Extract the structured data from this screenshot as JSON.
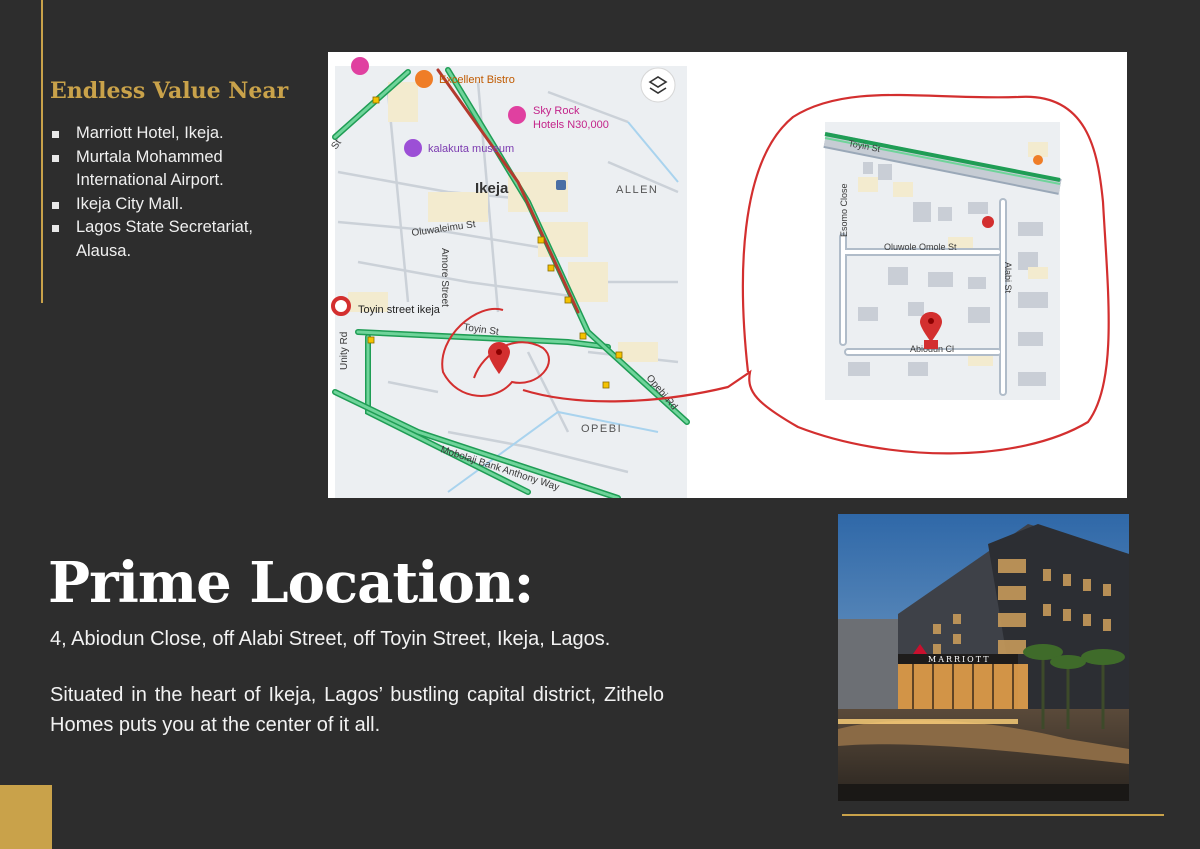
{
  "near": {
    "title": "Endless Value Near",
    "items": [
      "Marriott Hotel, Ikeja.",
      "Murtala Mohammed International Airport.",
      "Ikeja City Mall.",
      "Lagos State Secretariat, Alausa."
    ]
  },
  "map": {
    "excellent_bistro": "Excellent Bistro",
    "sky_rock_1": "Sky Rock",
    "sky_rock_2": "Hotels N30,000",
    "kalakuta": "kalakuta museum",
    "ikeja": "Ikeja",
    "allen": "ALLEN",
    "oluwaleimu": "Oluwaleimu St",
    "amore": "Amore Street",
    "toyin_ikeja": "Toyin street ikeja",
    "toyin_st": "Toyin St",
    "unity": "Unity Rd",
    "opebi_rd": "Opebi Rd",
    "opebi": "OPEBI",
    "mobolaji": "Mobolaji Bank Anthony Way",
    "st": "St",
    "zoom_toyin": "Toyin St",
    "zoom_esomo": "Esomo Close",
    "zoom_oluwole": "Oluwole Omole St",
    "zoom_alabi": "Alabi St",
    "zoom_abiodun": "Abiodun Cl"
  },
  "hotel_sign": "MARRIOTT",
  "headline": "Prime Location:",
  "address": "4, Abiodun Close, off Alabi Street, off Toyin Street, Ikeja, Lagos.",
  "description": "Situated in the heart of Ikeja, Lagos’ bustling capital district, Zithelo Homes puts you at the center of it all.",
  "colors": {
    "gold": "#c9a24a",
    "background": "#2d2d2d",
    "map_marker": "#d32f2f"
  }
}
